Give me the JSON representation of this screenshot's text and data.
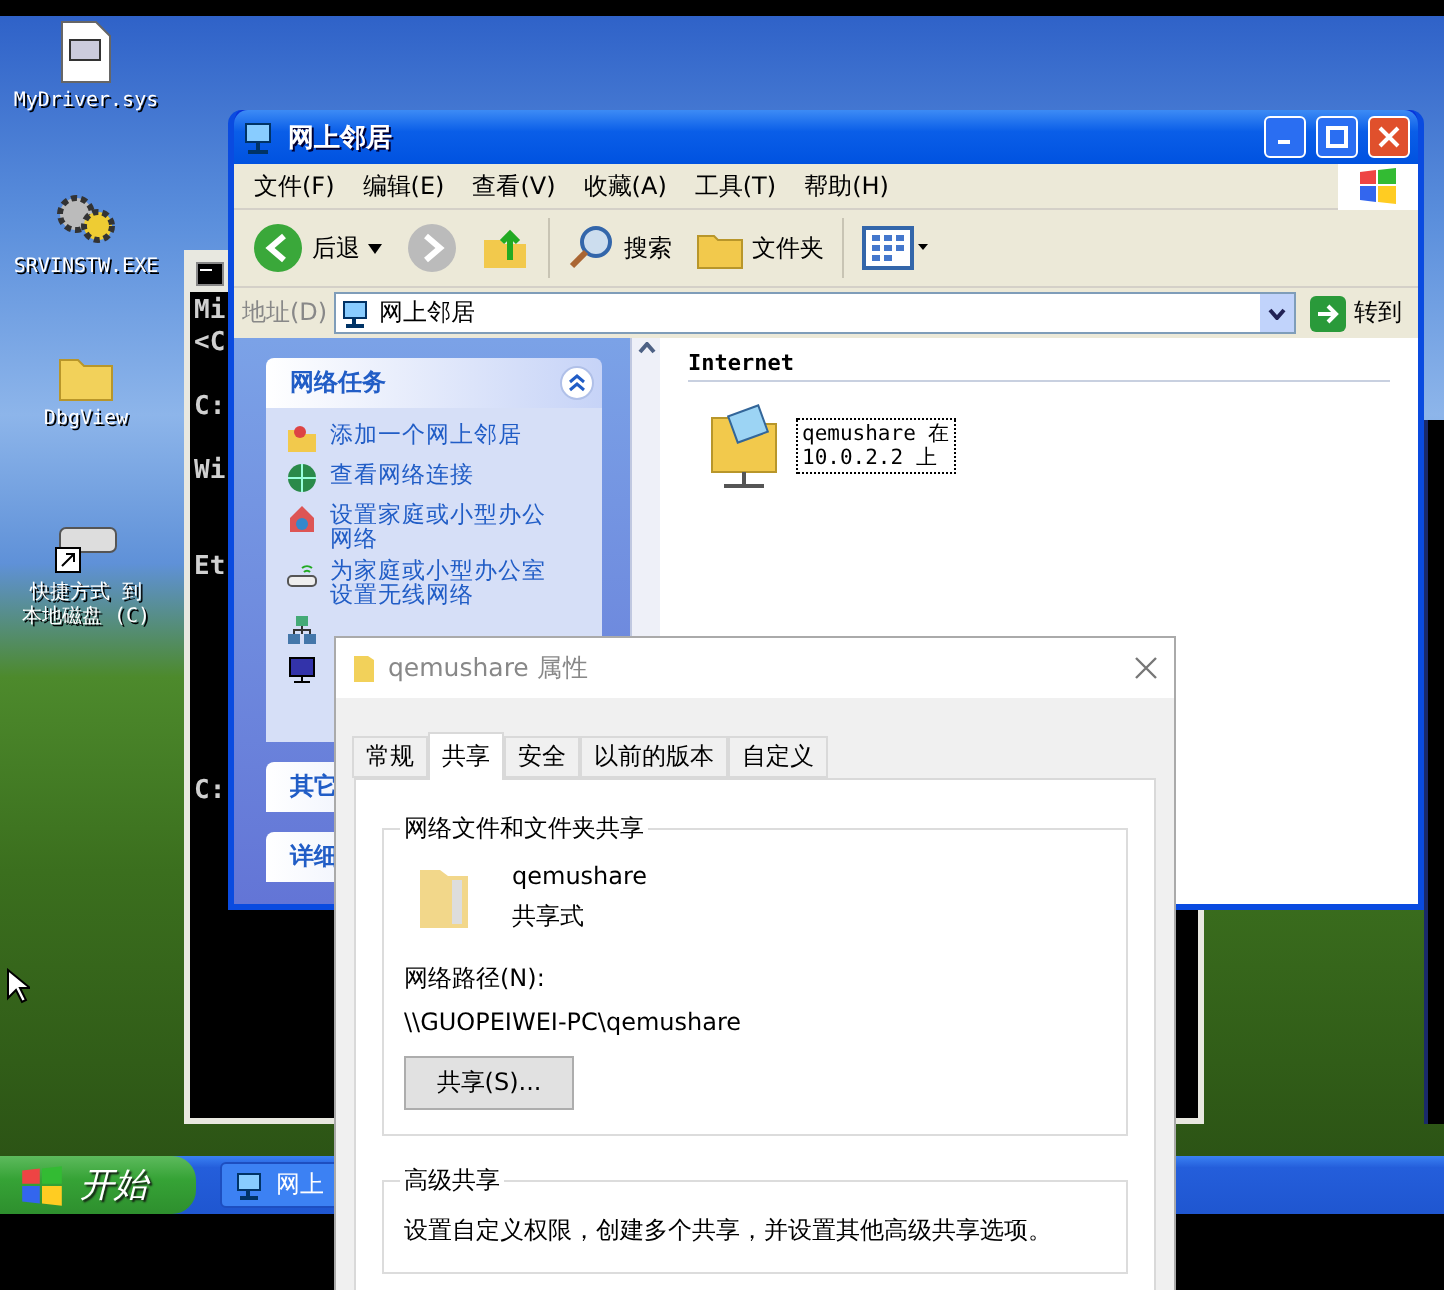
{
  "desktop_icons": [
    {
      "kind": "file",
      "lines": [
        "MyDriver.sys"
      ]
    },
    {
      "kind": "gears",
      "lines": [
        "SRVINSTW.EXE"
      ]
    },
    {
      "kind": "folder",
      "lines": [
        "DbgView"
      ]
    },
    {
      "kind": "drive",
      "lines": [
        "快捷方式 到",
        "本地磁盘 (C)"
      ]
    }
  ],
  "console": {
    "lines": [
      {
        "kind": "text",
        "text": "Mi"
      },
      {
        "kind": "text",
        "text": "<C"
      },
      {
        "kind": "blank"
      },
      {
        "kind": "text",
        "text": "C:"
      },
      {
        "kind": "blank"
      },
      {
        "kind": "text",
        "text": "Wi"
      },
      {
        "kind": "blank"
      },
      {
        "kind": "blank"
      },
      {
        "kind": "text",
        "text": "Et"
      },
      {
        "kind": "blank"
      },
      {
        "kind": "blank"
      },
      {
        "kind": "blank"
      },
      {
        "kind": "blank"
      },
      {
        "kind": "blank"
      },
      {
        "kind": "blank"
      },
      {
        "kind": "text",
        "text": "C:"
      }
    ]
  },
  "explorer": {
    "title": "网上邻居",
    "menu": [
      "文件(F)",
      "编辑(E)",
      "查看(V)",
      "收藏(A)",
      "工具(T)",
      "帮助(H)"
    ],
    "toolbar": [
      {
        "kind": "back",
        "label": "后退"
      },
      {
        "kind": "forward"
      },
      {
        "kind": "up"
      },
      {
        "kind": "search",
        "label": "搜索"
      },
      {
        "kind": "folders",
        "label": "文件夹"
      },
      {
        "kind": "views"
      }
    ],
    "address": {
      "label": "地址(D)",
      "value": "网上邻居",
      "go": "转到"
    },
    "tasks": {
      "title": "网络任务",
      "expanded": true,
      "items": [
        {
          "kind": "add",
          "lines": [
            "添加一个网上邻居"
          ]
        },
        {
          "kind": "globe",
          "lines": [
            "查看网络连接"
          ]
        },
        {
          "kind": "home",
          "lines": [
            "设置家庭或小型办公",
            "网络"
          ]
        },
        {
          "kind": "wireless",
          "lines": [
            "为家庭或小型办公室",
            "设置无线网络"
          ]
        },
        {
          "kind": "workgroup"
        },
        {
          "kind": "monitor"
        }
      ]
    },
    "other_panels": [
      "其它",
      "详细"
    ],
    "content": {
      "group": "Internet",
      "items": [
        {
          "lines": [
            "qemushare 在",
            "10.0.2.2 上"
          ],
          "focused": true
        }
      ]
    }
  },
  "dialog": {
    "title": "qemushare 属性",
    "tabs": [
      {
        "label": "常规",
        "selected": false
      },
      {
        "label": "共享",
        "selected": true
      },
      {
        "label": "安全",
        "selected": false
      },
      {
        "label": "以前的版本",
        "selected": false
      },
      {
        "label": "自定义",
        "selected": false
      }
    ],
    "share_group": {
      "title": "网络文件和文件夹共享",
      "name": "qemushare",
      "state": "共享式",
      "path_label": "网络路径(N):",
      "path": "\\\\GUOPEIWEI-PC\\qemushare",
      "button": "共享(S)..."
    },
    "advanced_group": {
      "title": "高级共享",
      "text": "设置自定义权限，创建多个共享，并设置其他高级共享选项。"
    }
  },
  "taskbar": {
    "start": "开始",
    "tasks": [
      {
        "label": "网上"
      }
    ]
  }
}
